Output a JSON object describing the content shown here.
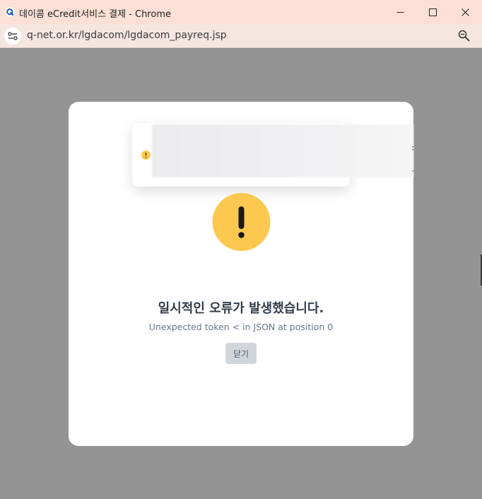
{
  "window": {
    "title": "데이콤 eCredit서비스 결제 - Chrome",
    "url": "q-net.or.kr/lgdacom/lgdacom_payreq.jsp",
    "favicon_letter": "Q"
  },
  "dialog": {
    "heading": "일시적인 오류가 발생했습니다.",
    "message": "Unexpected token < in JSON at position 0",
    "close_label": "닫기"
  },
  "icons": {
    "favicon": "q-net-icon",
    "site_info": "tune-icon",
    "zoom": "zoom-out-icon",
    "minimize": "minimize-icon",
    "maximize": "maximize-icon",
    "close": "close-icon",
    "warning": "warning-icon"
  },
  "colors": {
    "titlebar": "#fce0d6",
    "overlay": "#949494",
    "warning": "#fcc850",
    "button": "#d1d6db",
    "heading": "#333d4b"
  }
}
